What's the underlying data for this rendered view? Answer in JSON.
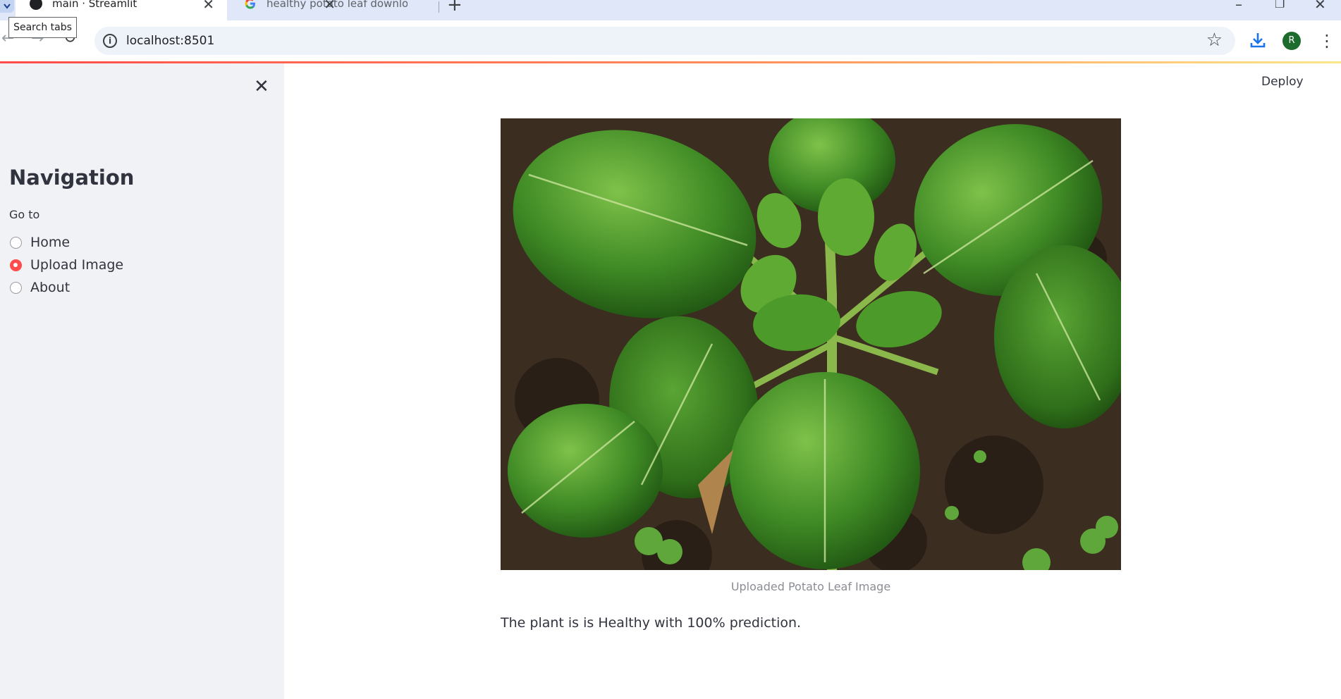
{
  "browser": {
    "tabs": [
      {
        "title": "main · Streamlit",
        "active": true
      },
      {
        "title": "healthy potato leaf download -",
        "active": false
      }
    ],
    "tooltip": "Search tabs",
    "url": "localhost:8501",
    "profile_initial": "R",
    "icons": [
      "tab-search-icon",
      "back-icon",
      "forward-icon",
      "reload-icon",
      "info-icon",
      "star-icon",
      "download-icon",
      "menu-icon",
      "new-tab-icon",
      "minimize-icon",
      "maximize-icon",
      "close-window-icon"
    ]
  },
  "sidebar": {
    "title": "Navigation",
    "radio_label": "Go to",
    "options": [
      {
        "label": "Home",
        "selected": false
      },
      {
        "label": "Upload Image",
        "selected": true
      },
      {
        "label": "About",
        "selected": false
      }
    ]
  },
  "header": {
    "deploy_label": "Deploy"
  },
  "main": {
    "image_caption": "Uploaded Potato Leaf Image",
    "result_text": "The plant is is Healthy with 100% prediction."
  },
  "colors": {
    "accent": "#ff4b4b",
    "sidebar_bg": "#f0f2f6",
    "text": "#31333f"
  }
}
